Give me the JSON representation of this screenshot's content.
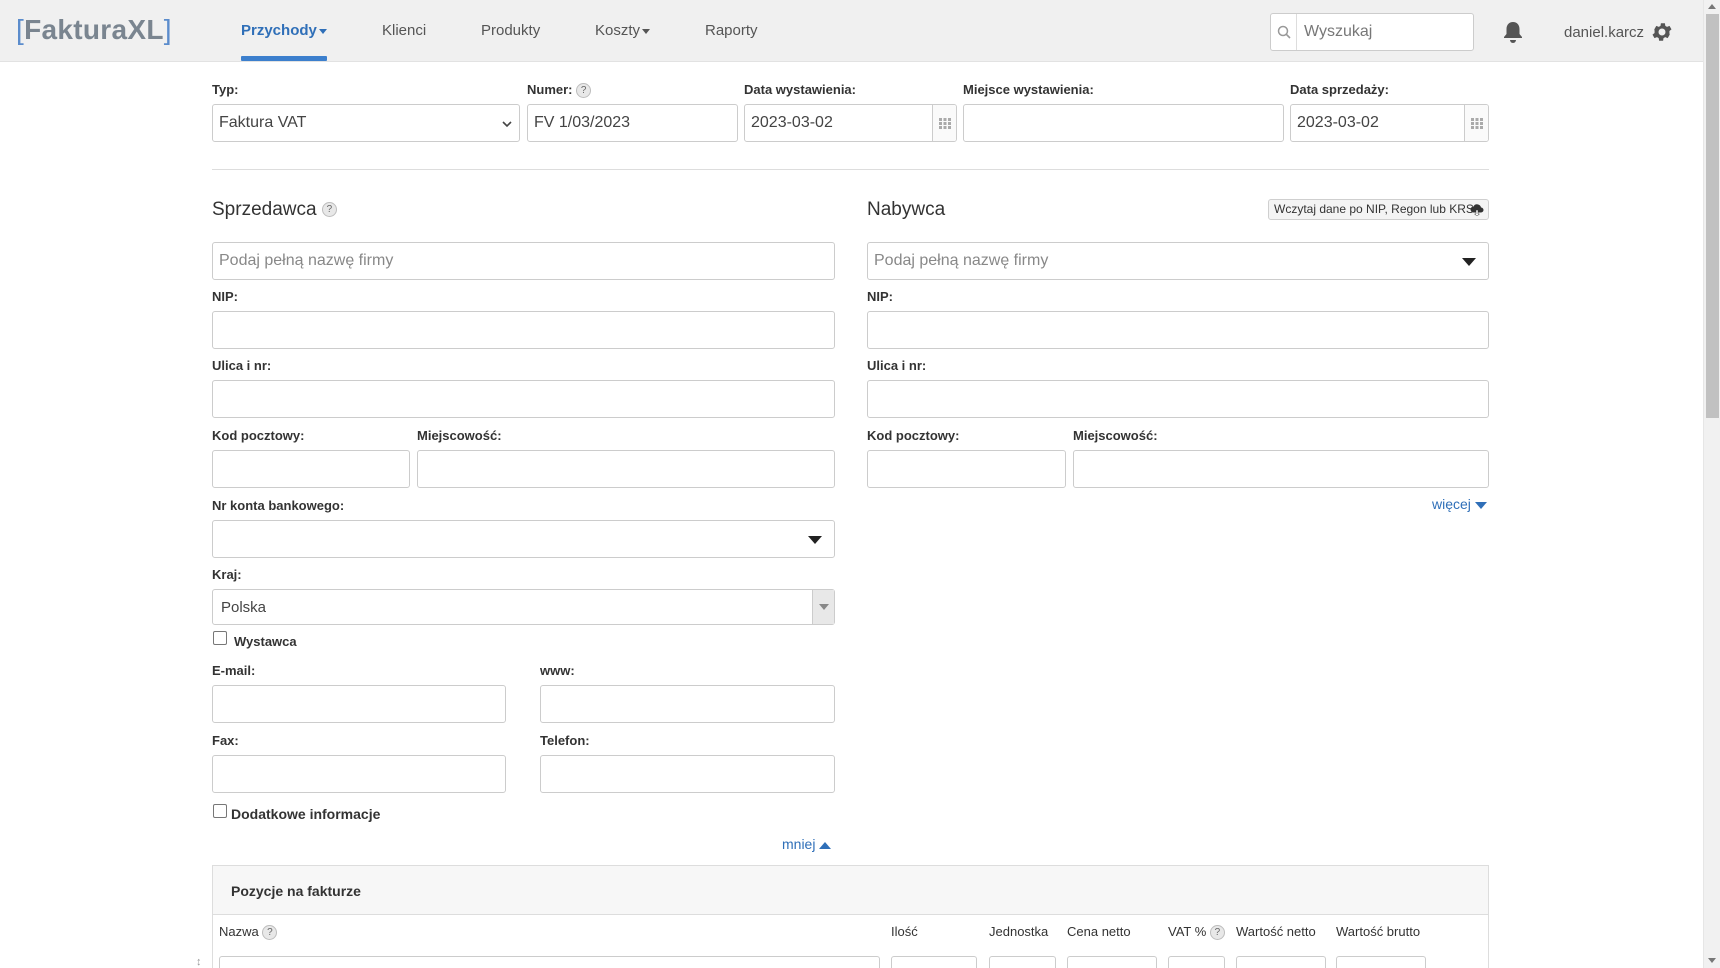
{
  "app": {
    "logo_left_bracket": "[",
    "logo_text": "FakturaXL",
    "logo_right_bracket": "]"
  },
  "nav": {
    "items": [
      {
        "label": "Przychody",
        "active": true,
        "has_dropdown": true
      },
      {
        "label": "Klienci",
        "active": false,
        "has_dropdown": false
      },
      {
        "label": "Produkty",
        "active": false,
        "has_dropdown": false
      },
      {
        "label": "Koszty",
        "active": false,
        "has_dropdown": true
      },
      {
        "label": "Raporty",
        "active": false,
        "has_dropdown": false
      }
    ],
    "search_placeholder": "Wyszukaj",
    "username": "daniel.karcz"
  },
  "header_fields": {
    "type_label": "Typ:",
    "type_value": "Faktura VAT",
    "number_label": "Numer:",
    "number_value": "FV 1/03/2023",
    "issue_date_label": "Data wystawienia:",
    "issue_date_value": "2023-03-02",
    "issue_place_label": "Miejsce wystawienia:",
    "issue_place_value": "",
    "sale_date_label": "Data sprzedaży:",
    "sale_date_value": "2023-03-02"
  },
  "seller": {
    "title": "Sprzedawca",
    "name_placeholder": "Podaj pełną nazwę firmy",
    "nip_label": "NIP:",
    "street_label": "Ulica i nr:",
    "postal_label": "Kod pocztowy:",
    "city_label": "Miejscowość:",
    "bank_label": "Nr konta bankowego:",
    "country_label": "Kraj:",
    "country_value": "Polska",
    "issuer_checkbox_label": "Wystawca",
    "email_label": "E-mail:",
    "www_label": "www:",
    "fax_label": "Fax:",
    "phone_label": "Telefon:",
    "extra_info_label": "Dodatkowe informacje",
    "less_link": "mniej"
  },
  "buyer": {
    "title": "Nabywca",
    "load_button": "Wczytaj dane po NIP, Regon lub KRS",
    "name_placeholder": "Podaj pełną nazwę firmy",
    "nip_label": "NIP:",
    "street_label": "Ulica i nr:",
    "postal_label": "Kod pocztowy:",
    "city_label": "Miejscowość:",
    "more_link": "więcej"
  },
  "items": {
    "title": "Pozycje na fakturze",
    "columns": [
      "Nazwa",
      "Ilość",
      "Jednostka",
      "Cena netto",
      "VAT %",
      "Wartość netto",
      "Wartość brutto"
    ]
  },
  "colors": {
    "accent": "#2f6fb8",
    "navbar_bg": "#f0f0f0",
    "logo_gray": "#7a8590"
  },
  "icons": [
    "search-icon",
    "bell-icon",
    "gear-icon",
    "calendar-icon",
    "help-icon",
    "cloud-download-icon"
  ]
}
